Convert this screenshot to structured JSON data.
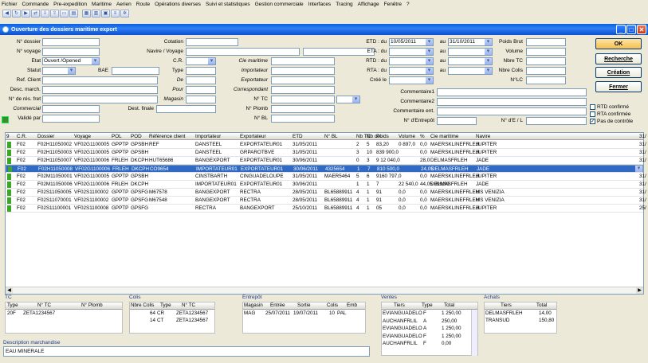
{
  "menu": [
    "Fichier",
    "Commande",
    "Pre-expedition",
    "Maritime",
    "Aerien",
    "Route",
    "Opérations diverses",
    "Suivi et statistiques",
    "Gestion commerciale",
    "Interfaces",
    "Tracing",
    "Affichage",
    "Fenêtre",
    "?"
  ],
  "window": {
    "title": "Ouverture des dossiers maritime export"
  },
  "form": {
    "n_dossier": "N° dossier",
    "n_voyage": "N° voyage",
    "etat": "Etat",
    "etat_value": "Ouvert /Opened",
    "statut": "Statut",
    "bae": "BAE",
    "ref_client": "Ref. Client",
    "desc_march": "Desc. march.",
    "n_res_fret": "N° de rés. fret",
    "commercial": "Commercial",
    "valide_par": "Validé par",
    "cotation": "Cotation",
    "navire_voyage": "Navire / Voyage",
    "cr": "C.R.",
    "type": "Type",
    "de": "De",
    "pour": "Pour",
    "magasin": "Magasin",
    "dest_finale": "Dest. finale",
    "cie_maritime": "Cie maritime",
    "importateur": "Importateur",
    "exportateur": "Exportateur",
    "correspondant": "Correspondant",
    "n_tc": "N° TC",
    "n_plomb": "N° Plomb",
    "n_bl": "N° BL",
    "etd": "ETD : du",
    "etd_from": "10/05/2011",
    "etd_to": "31/10/2011",
    "eta": "ETA : du",
    "rtd": "RTD : du",
    "rta": "RTA : du",
    "au": "au",
    "cree_le": "Créé le",
    "commentaire1": "Commentaire1",
    "commentaire2": "Commentaire2",
    "commentaire_ent": "Commentaire ent.",
    "n_entrepot": "N° d'Entrepôt",
    "poids_brut": "Poids Brut",
    "volume": "Volume",
    "nbre_tc": "Nbre TC",
    "nbre_colis": "Nbre Colis",
    "n_lc": "N°LC",
    "n_de_l": "N° d'E / L"
  },
  "buttons": {
    "ok": "OK",
    "recherche": "Recherche",
    "creation": "Création",
    "fermer": "Fermer"
  },
  "checks": [
    {
      "label": "RTD confirmé",
      "checked": false
    },
    {
      "label": "RTA confirmée",
      "checked": false
    },
    {
      "label": "Pas de contrôle",
      "checked": true
    }
  ],
  "grid": {
    "headers": [
      "9",
      "C.R.",
      "Dossier",
      "Voyage",
      "POL",
      "POD",
      "Référence client",
      "Importateur",
      "Exportateur",
      "ETD",
      "N° BL",
      "Nb TC",
      "Nb col.",
      "Poids",
      "Volume",
      "%",
      "Cie maritime",
      "Navire",
      "31/"
    ],
    "rows": [
      [
        "",
        "F02",
        "F02H11050002",
        "VF02G1100005",
        "GPPTP",
        "GPSBH",
        "REF",
        "DANSTEEL",
        "EXPORTATEUR01",
        "31/05/2011",
        "",
        "2",
        "5",
        "83,20",
        "0 897,0",
        "0,0",
        "MAERSKLINEFRLEH",
        "JUPITER",
        "31/"
      ],
      [
        "",
        "F02",
        "F02H11050003",
        "VF02G1100005",
        "GPPTP",
        "GPSBH",
        "",
        "DANSTEEL",
        "GRPAROTBVE",
        "31/05/2011",
        "",
        "3",
        "10",
        "839 900,0",
        "",
        "0,0",
        "MAERSKLINEFRLEH",
        "JUPITER",
        "31/"
      ],
      [
        "",
        "F02",
        "F02H11050007",
        "VF02G1100006",
        "FRLEH",
        "DKCPH",
        "HUT65686",
        "BANGEXPORT",
        "EXPORTATEUR01",
        "30/06/2011",
        "",
        "0",
        "3",
        "9 12 040,0",
        "",
        "28,0",
        "DELMASFRLEH",
        "JADE",
        "31/"
      ],
      [
        "",
        "F02",
        "F02H11050008",
        "VF02G1100006",
        "FRLEH",
        "DKCPH",
        "CO9654",
        "IMPORTATEUR01",
        "EXPORTATEUR01",
        "30/06/2011",
        "4325654",
        "1",
        "7",
        "810 500,0",
        "",
        "24,05",
        "DELMASFRLEH",
        "JADE",
        "31/"
      ],
      [
        "",
        "F02",
        "F02M11050001",
        "VF02G1100005",
        "GPPTP",
        "GPSBH",
        "",
        "CINSTBARTH",
        "CINGUADELOUPE",
        "31/05/2011",
        "MAER5464",
        "5",
        "6",
        "9160 797,0",
        "",
        "0,0",
        "MAERSKLINEFRLEH",
        "JUPITER",
        "31/"
      ],
      [
        "",
        "F02",
        "F02M11050006",
        "VF02G1100006",
        "FRLEH",
        "DKCPH",
        "",
        "IMPORTATEUR01",
        "EXPORTATEUR01",
        "30/06/2011",
        "",
        "1",
        "1",
        "7",
        "22 540,0",
        "44,05 999,99",
        "DELMASFRLEH",
        "JADE",
        "31/"
      ],
      [
        "",
        "F02",
        "F02S11050005",
        "VF02S1100002",
        "GPPTP",
        "GPSFG",
        "M67578",
        "BANGEXPORT",
        "RECTRA",
        "28/05/2011",
        "BL65889911",
        "4",
        "1",
        "91",
        "0,0",
        "0,0",
        "MAERSKLINEFRLEH",
        "MS VENIZIA",
        "31/"
      ],
      [
        "",
        "F02",
        "F02S11070001",
        "VF02S1100002",
        "GPPTP",
        "GPSFG",
        "M67548",
        "BANGEXPORT",
        "RECTRA",
        "28/05/2011",
        "BL65889911",
        "4",
        "1",
        "91",
        "0,0",
        "0,0",
        "MAERSKLINEFRLEH",
        "MS VENIZIA",
        "31/"
      ],
      [
        "",
        "F02",
        "F02S11100001",
        "VF02S1100008",
        "GPPTP",
        "GPSFG",
        "",
        "RECTRA",
        "BANGEXPORT",
        "25/10/2011",
        "BL65889911",
        "4",
        "1",
        "05",
        "0,0",
        "0,0",
        "MAERSKLINEFRLEH",
        "JUPITER",
        "25/"
      ]
    ],
    "selected_index": 3
  },
  "tc": {
    "title": "TC",
    "headers": [
      "Type",
      "N° TC",
      "N° Plomb"
    ],
    "rows": [
      [
        "20F",
        "ZETA1234567",
        ""
      ]
    ]
  },
  "colis": {
    "title": "Colis",
    "headers": [
      "Nbre Colis",
      "Type",
      "N° TC"
    ],
    "rows": [
      [
        "64",
        "CR",
        "ZETA1234567"
      ],
      [
        "14",
        "CT",
        "ZETA1234567"
      ]
    ]
  },
  "entrepot": {
    "title": "Entrepôt",
    "headers": [
      "Magasin",
      "Entrée",
      "Sortie",
      "Colis",
      "Emb"
    ],
    "rows": [
      [
        "MAG",
        "25/07/2011",
        "19/07/2011",
        "10",
        "PAL"
      ]
    ]
  },
  "ventes": {
    "title": "Ventes",
    "headers": [
      "Tiers",
      "Type",
      "Total"
    ],
    "rows": [
      [
        "EVIANGUADELO",
        "F",
        "1 250,00"
      ],
      [
        "AUCHANFRLIL",
        "A",
        "250,00"
      ],
      [
        "EVIANGUADELO",
        "A",
        "1 250,00"
      ],
      [
        "EVIANGUADELO",
        "F",
        "1 250,00"
      ],
      [
        "AUCHANFRLIL",
        "F",
        "0,00"
      ]
    ]
  },
  "achats": {
    "title": "Achats",
    "headers": [
      "Tiers",
      "Total"
    ],
    "rows": [
      [
        "DELMASFRLEH",
        "14,00"
      ],
      [
        "TRANSUD",
        "150,80"
      ]
    ]
  },
  "description": {
    "title": "Description marchandise",
    "value": "EAU MINERALE"
  }
}
